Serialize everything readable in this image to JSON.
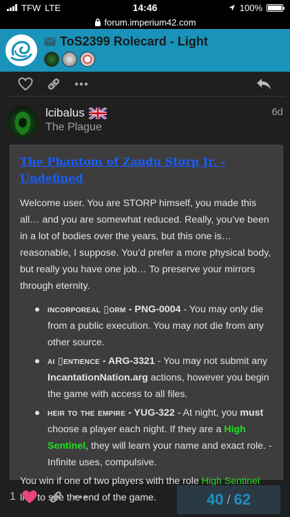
{
  "status": {
    "carrier": "TFW",
    "network": "LTE",
    "time": "14:46",
    "battery": "100%",
    "battery_level": 1.0
  },
  "browser": {
    "url": "forum.imperium42.com"
  },
  "header": {
    "title": "ToS2399 Rolecard - Light"
  },
  "post": {
    "username": "lcibalus",
    "user_title": "The Plague",
    "age": "6d",
    "link": "The Phantom of Zandu Storp Jr. - Undefined",
    "intro": "Welcome user. You are STORP himself, you made this all… and you are somewhat reduced. Really, you’ve been in a lot of bodies over the years, but this one is… reasonable, I suppose. You’d prefer a more physical body, but really you have one job… To preserve your mirrors through eternity.",
    "abilities": [
      {
        "name": "incorporeal ▯orm",
        "code": " - PNG-0004",
        "text": " - You may only die from a public execution. You may not die from any other source."
      },
      {
        "name": "ai ▯entience",
        "code": " - ARG-3321",
        "text_a": " - You may not submit any ",
        "bold": "IncantationNation.arg",
        "text_b": " actions, however you begin the game with access to all files."
      },
      {
        "name": "heir to the empire",
        "code": " - YUG-322",
        "text_a": " - At night, you ",
        "bold": "must",
        "text_b": " choose a player each night. If they are a ",
        "green": "High Sentinel",
        "text_c": ", they will learn your name and exact role. - Infinite uses, compulsive."
      }
    ],
    "win_a": "You win if one of two players with the role ",
    "win_green": "High Sentinel",
    "win_b": " live to see the end of the game."
  },
  "footer": {
    "like_count": "1",
    "current": "40",
    "separator": "/",
    "total": "62"
  },
  "colors": {
    "header_bg": "#1993b9",
    "link": "#1a5cff",
    "highlight": "#22e022",
    "like": "#e8457a"
  }
}
